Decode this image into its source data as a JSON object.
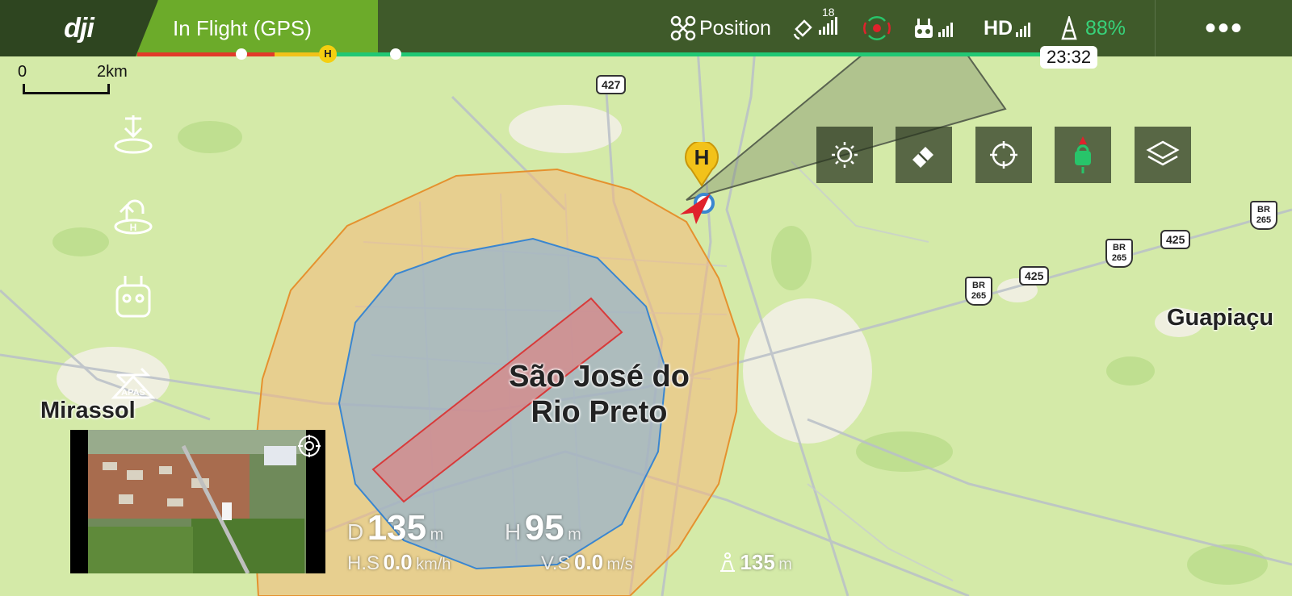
{
  "header": {
    "brand": "dji",
    "flight_status": "In Flight (GPS)",
    "flight_mode": "Position",
    "gps_satellites": "18",
    "video_label": "HD",
    "battery_percent": "88%",
    "remaining_time": "23:32",
    "more": "•••",
    "home_marker": "H"
  },
  "map": {
    "scale_start": "0",
    "scale_end": "2km",
    "city_main_line1": "São José do",
    "city_main_line2": "Rio Preto",
    "city_left": "Mirassol",
    "city_right": "Guapiaçu",
    "road_427": "427",
    "road_425a": "425",
    "road_425b": "425",
    "br_top": "BR",
    "br_top_num": "265",
    "br_mid_num": "265",
    "br_low_num": "265",
    "home_label": "H",
    "apas_label": "APAS"
  },
  "telemetry": {
    "d_label": "D",
    "d_value": "135",
    "d_unit": "m",
    "h_label": "H",
    "h_value": "95",
    "h_unit": "m",
    "hs_label": "H.S",
    "hs_value": "0.0",
    "hs_unit": "km/h",
    "vs_label": "V.S",
    "vs_value": "0.0",
    "vs_unit": "m/s",
    "dist_value": "135",
    "dist_unit": "m"
  },
  "colors": {
    "accent_green": "#6cab2a",
    "battery_green": "#37d27a",
    "zone_orange": "#f5b87a",
    "zone_blue": "#8eb2d6",
    "zone_red": "#e27a7a"
  }
}
